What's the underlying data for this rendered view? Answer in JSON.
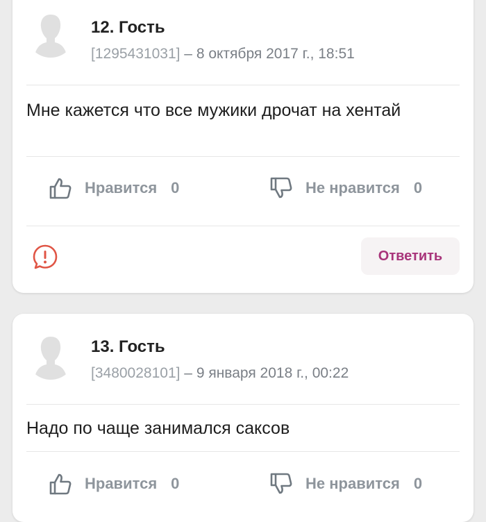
{
  "comments": [
    {
      "author": "12. Гость",
      "id": "[1295431031]",
      "date": " – 8 октября 2017 г., 18:51",
      "text": "Мне кажется что все мужики дрочат на хентай",
      "like_label": "Нравится",
      "like_count": "0",
      "dislike_label": "Не нравится",
      "dislike_count": "0",
      "reply_label": "Ответить"
    },
    {
      "author": "13. Гость",
      "id": "[3480028101]",
      "date": " – 9 января 2018 г., 00:22",
      "text": "Надо по чаще занимался саксов",
      "like_label": "Нравится",
      "like_count": "0",
      "dislike_label": "Не нравится",
      "dislike_count": "0"
    }
  ],
  "icons": {
    "avatar": "user-silhouette-icon",
    "like": "thumbs-up-icon",
    "dislike": "thumbs-down-icon",
    "report": "alert-bubble-icon"
  },
  "colors": {
    "accent": "#a8347a",
    "report": "#e05545",
    "muted": "#8e959c"
  }
}
